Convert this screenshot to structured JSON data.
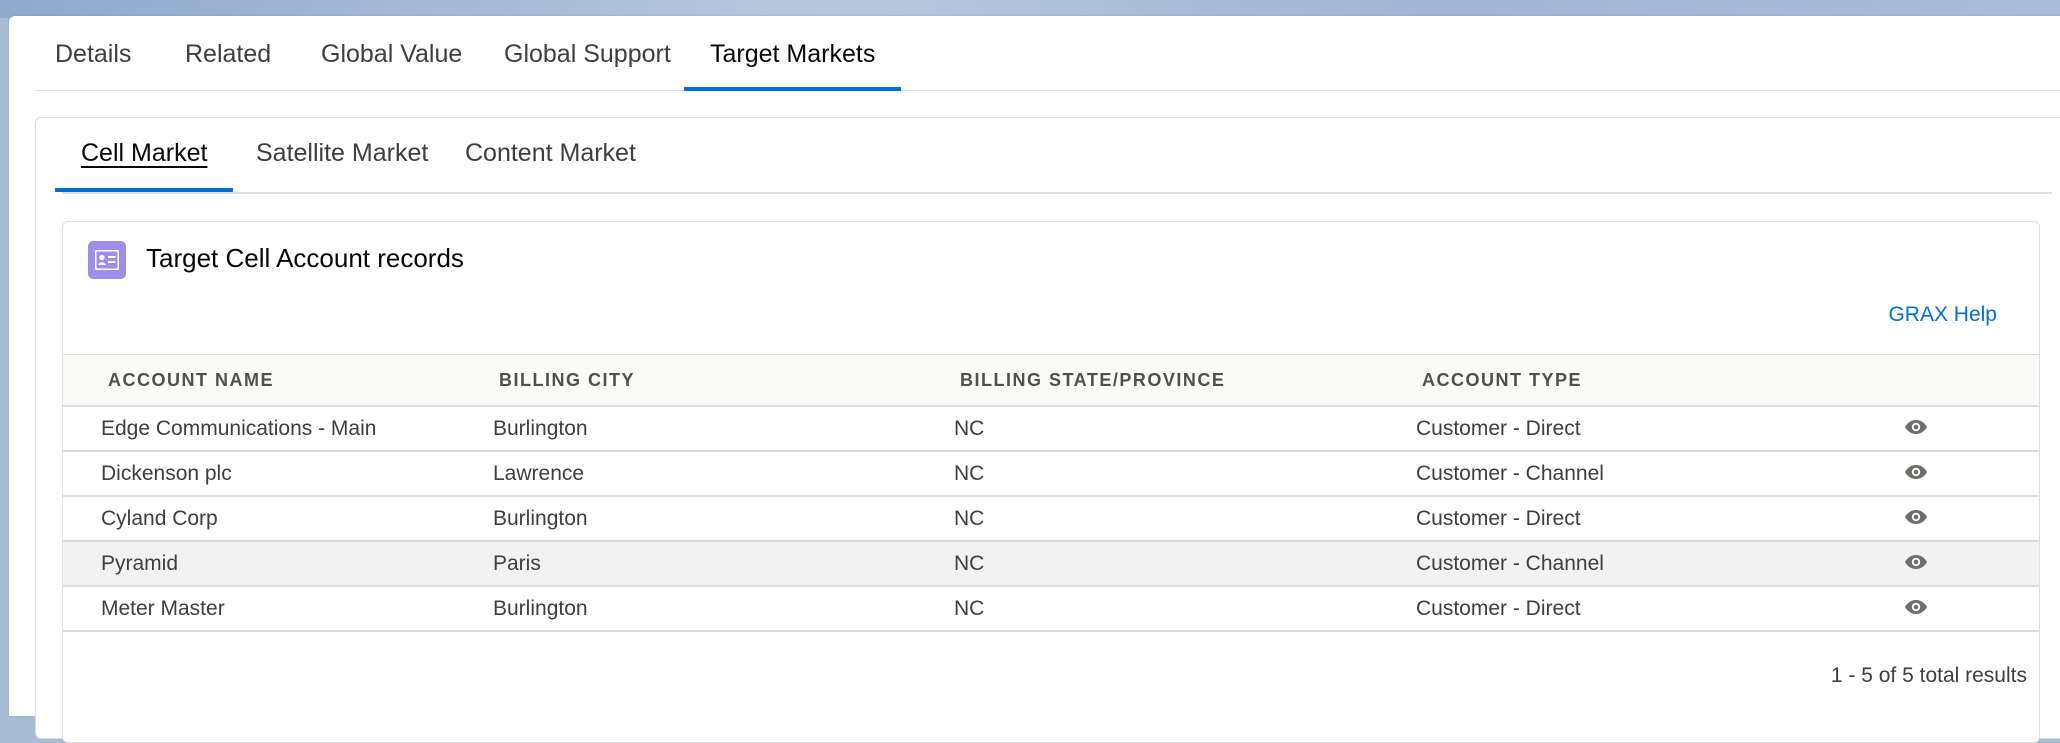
{
  "top_tabs": [
    {
      "label": "Details"
    },
    {
      "label": "Related"
    },
    {
      "label": "Global Value"
    },
    {
      "label": "Global Support"
    },
    {
      "label": "Target Markets",
      "active": true
    }
  ],
  "sub_tabs": [
    {
      "label": "Cell Market",
      "active": true
    },
    {
      "label": "Satellite Market"
    },
    {
      "label": "Content Market"
    }
  ],
  "related_list": {
    "icon": "contact-card-icon",
    "icon_color": "#9f8ee8",
    "title": "Target Cell Account records",
    "help_link": "GRAX Help",
    "columns": [
      "ACCOUNT NAME",
      "BILLING CITY",
      "BILLING STATE/PROVINCE",
      "ACCOUNT TYPE"
    ],
    "rows": [
      {
        "name": "Edge Communications - Main",
        "city": "Burlington",
        "state": "NC",
        "type": "Customer - Direct"
      },
      {
        "name": "Dickenson plc",
        "city": "Lawrence",
        "state": "NC",
        "type": "Customer - Channel"
      },
      {
        "name": "Cyland Corp",
        "city": "Burlington",
        "state": "NC",
        "type": "Customer - Direct"
      },
      {
        "name": "Pyramid",
        "city": "Paris",
        "state": "NC",
        "type": "Customer - Channel"
      },
      {
        "name": "Meter Master",
        "city": "Burlington",
        "state": "NC",
        "type": "Customer - Direct"
      }
    ],
    "row_action_icon": "eye-icon",
    "footer": "1 - 5 of 5 total results"
  },
  "colors": {
    "link": "#0070d2",
    "active_tab_underline": "#0070d2"
  }
}
